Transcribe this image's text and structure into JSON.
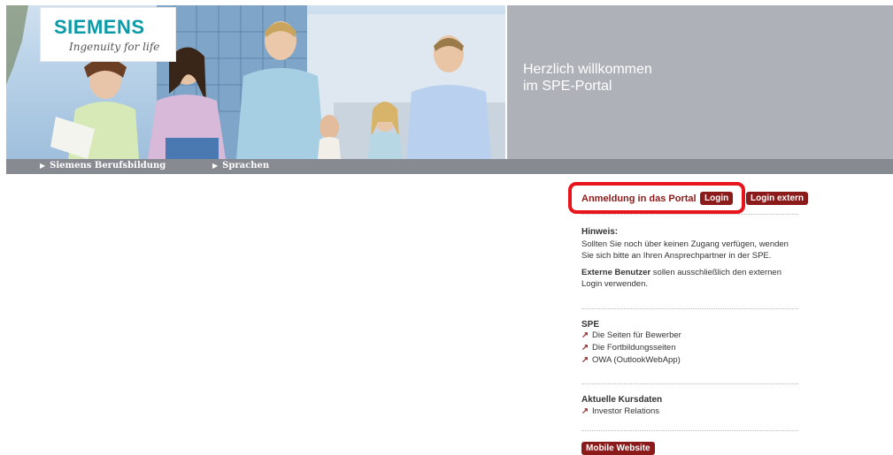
{
  "header": {
    "logo_word": "SIEMENS",
    "logo_tagline": "Ingenuity for life",
    "welcome_line1": "Herzlich willkommen",
    "welcome_line2": "im SPE-Portal"
  },
  "nav": {
    "items": [
      {
        "label": "Siemens Berufsbildung"
      },
      {
        "label": "Sprachen"
      }
    ]
  },
  "login": {
    "label": "Anmeldung in das Portal",
    "login_button": "Login",
    "login_extern_button": "Login extern"
  },
  "hinweis": {
    "heading": "Hinweis:",
    "line1": "Sollten Sie noch über keinen Zugang verfügen, wenden",
    "line2": "Sie sich bitte an Ihren Ansprechpartner in der SPE.",
    "extern_bold": "Externe Benutzer",
    "extern_rest": " sollen ausschließlich den externen",
    "extern_line2": "Login verwenden."
  },
  "spe": {
    "heading": "SPE",
    "links": [
      {
        "label": "Die Seiten für Bewerber"
      },
      {
        "label": "Die Fortbildungsseiten"
      },
      {
        "label": "OWA (OutlookWebApp)"
      }
    ]
  },
  "kurs": {
    "heading": "Aktuelle Kursdaten",
    "links": [
      {
        "label": "Investor Relations"
      }
    ]
  },
  "mobile_button": "Mobile Website",
  "icons": {
    "nav_marker": "triangle-right-icon",
    "link_marker": "arrow-up-right-icon"
  },
  "colors": {
    "brand_teal": "#0a9aa8",
    "accent_red": "#8b1a1a",
    "highlight_red": "#e8141b",
    "panel_gray": "#aeb1b8",
    "nav_gray": "#878a91"
  }
}
